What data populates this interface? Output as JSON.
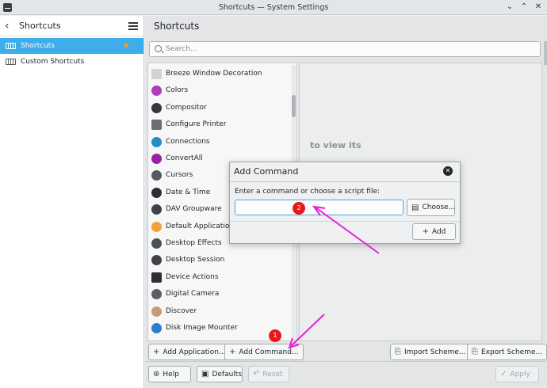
{
  "window": {
    "title": "Shortcuts — System Settings",
    "controls": [
      {
        "name": "minimize",
        "glyph": "⌄"
      },
      {
        "name": "maximize",
        "glyph": "⌃"
      },
      {
        "name": "close",
        "glyph": "✕"
      }
    ]
  },
  "sidebar": {
    "title": "Shortcuts",
    "items": [
      {
        "label": "Shortcuts",
        "active": true,
        "icon": "keyboard-icon",
        "badge_icon": "star-icon"
      },
      {
        "label": "Custom Shortcuts",
        "active": false,
        "icon": "keyboard-icon"
      }
    ]
  },
  "main": {
    "title": "Shortcuts",
    "search_placeholder": "Search...",
    "hint_text": "to view its",
    "list": [
      {
        "label": "Breeze Window Decoration",
        "icon": "window-decoration-icon",
        "color": "#d0d3d6"
      },
      {
        "label": "Colors",
        "icon": "colors-icon",
        "color": "#b03ac0"
      },
      {
        "label": "Compositor",
        "icon": "compositor-icon",
        "color": "#333840"
      },
      {
        "label": "Configure Printer",
        "icon": "printer-icon",
        "color": "#6a6e73"
      },
      {
        "label": "Connections",
        "icon": "connections-icon",
        "color": "#1e8fc9"
      },
      {
        "label": "ConvertAll",
        "icon": "convertall-icon",
        "color": "#9b1fa4"
      },
      {
        "label": "Cursors",
        "icon": "cursor-icon",
        "color": "#555a60"
      },
      {
        "label": "Date & Time",
        "icon": "clock-icon",
        "color": "#2c3035"
      },
      {
        "label": "DAV Groupware",
        "icon": "dav-groupware-icon",
        "color": "#3d4248"
      },
      {
        "label": "Default Applications",
        "icon": "default-apps-icon",
        "color": "#f0a33a"
      },
      {
        "label": "Desktop Effects",
        "icon": "desktop-effects-icon",
        "color": "#4b5158"
      },
      {
        "label": "Desktop Session",
        "icon": "desktop-session-icon",
        "color": "#3d4248"
      },
      {
        "label": "Device Actions",
        "icon": "device-actions-icon",
        "color": "#2c3035"
      },
      {
        "label": "Digital Camera",
        "icon": "camera-icon",
        "color": "#5a5f65"
      },
      {
        "label": "Discover",
        "icon": "discover-icon",
        "color": "#c49a78"
      },
      {
        "label": "Disk Image Mounter",
        "icon": "disk-image-icon",
        "color": "#2a7fd0"
      }
    ],
    "buttons": {
      "add_application": "Add Application...",
      "add_command": "Add Command...",
      "import_scheme": "Import Scheme...",
      "export_scheme": "Export Scheme...",
      "help": "Help",
      "defaults": "Defaults",
      "reset": "Reset",
      "apply": "Apply"
    }
  },
  "dialog": {
    "title": "Add Command",
    "prompt": "Enter a command or choose a script file:",
    "input_value": "",
    "choose_label": "Choose...",
    "add_label": "Add"
  },
  "annotations": {
    "marker_color": "#e81919",
    "arrow_color": "#e620d8",
    "markers": [
      {
        "label": "1"
      },
      {
        "label": "2"
      }
    ]
  }
}
